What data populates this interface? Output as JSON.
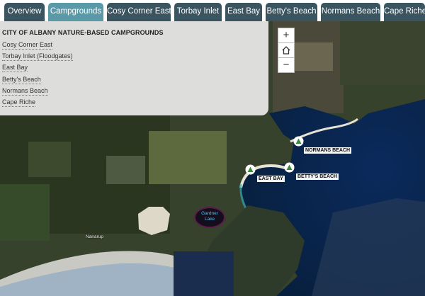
{
  "tabs": [
    {
      "label": "Overview",
      "active": false
    },
    {
      "label": "Campgrounds",
      "active": true
    },
    {
      "label": "Cosy Corner East",
      "active": false
    },
    {
      "label": "Torbay Inlet",
      "active": false
    },
    {
      "label": "East Bay",
      "active": false
    },
    {
      "label": "Betty's Beach",
      "active": false
    },
    {
      "label": "Normans Beach",
      "active": false
    },
    {
      "label": "Cape Riche",
      "active": false
    }
  ],
  "panel": {
    "title": "CITY OF ALBANY NATURE-BASED CAMPGROUNDS",
    "links": [
      "Cosy Corner East",
      "Torbay Inlet (Floodgates)",
      "East Bay",
      "Betty's Beach",
      "Normans Beach",
      "Cape Riche"
    ]
  },
  "map": {
    "zoom_in": "+",
    "zoom_out": "−",
    "home_icon": "home-icon",
    "campsites": [
      "NORMANS BEACH",
      "EAST BAY",
      "BETTY'S BEACH"
    ],
    "lake": "Gardner Lake",
    "town": "Nanarup"
  },
  "colors": {
    "tab_bg": "#3b5560",
    "tab_active": "#5a9aa8",
    "campsite_marker": "#ffffff",
    "campsite_tent": "#3c8a3c",
    "ocean": "#0a2a55"
  }
}
